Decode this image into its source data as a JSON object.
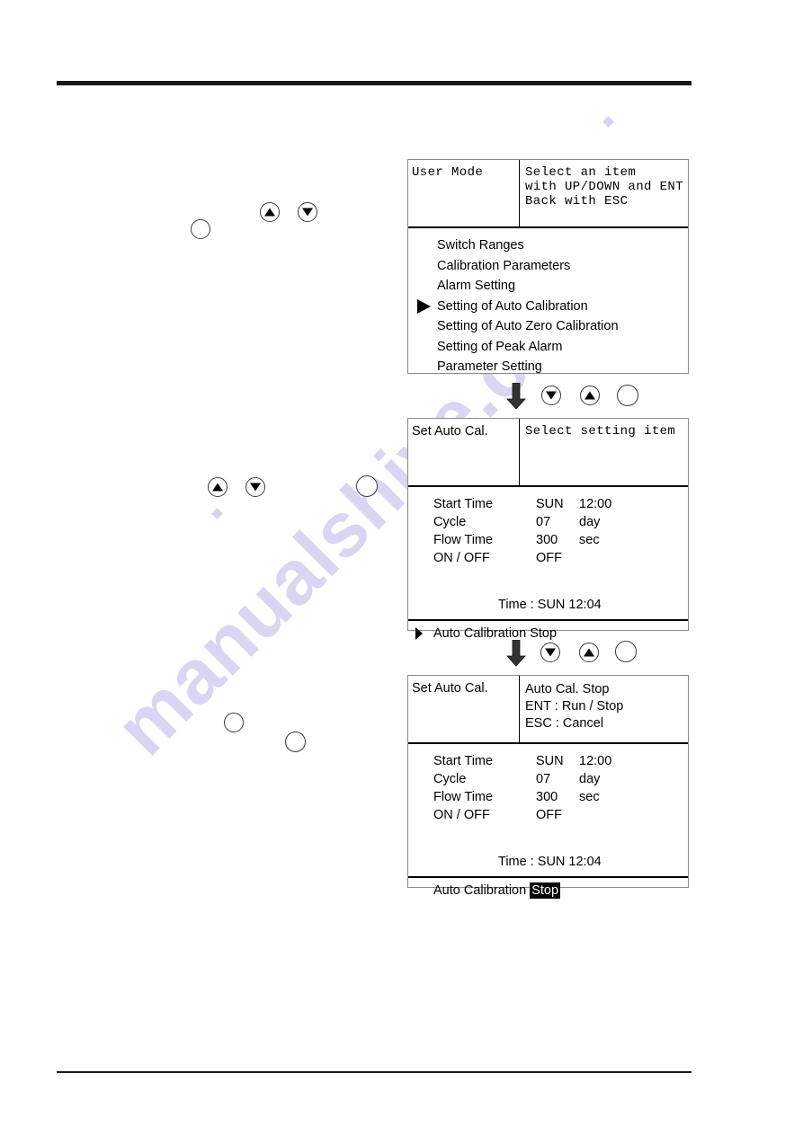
{
  "document": {
    "type": "instrument-manual-page",
    "rules": {
      "top": "horizontal-rule",
      "bottom": "horizontal-rule"
    },
    "watermark": "manualshive.com"
  },
  "panels": [
    {
      "id": "user-mode",
      "title": "User Mode",
      "guidance": [
        "Select an item",
        "with UP/DOWN and ENT",
        "Back with ESC"
      ],
      "menu": [
        {
          "label": "Switch Ranges",
          "selected": false
        },
        {
          "label": "Calibration Parameters",
          "selected": false
        },
        {
          "label": "Alarm Setting",
          "selected": false
        },
        {
          "label": "Setting of Auto Calibration",
          "selected": true
        },
        {
          "label": "Setting of Auto Zero Calibration",
          "selected": false
        },
        {
          "label": "Setting of Peak Alarm",
          "selected": false
        },
        {
          "label": "Parameter Setting",
          "selected": false
        }
      ]
    },
    {
      "id": "set-auto-cal-select",
      "title": "Set Auto Cal.",
      "guidance": [
        "Select setting item"
      ],
      "settings": [
        {
          "label": "Start  Time",
          "value": "SUN",
          "unit": "12:00"
        },
        {
          "label": "Cycle",
          "value": "07",
          "unit": "day"
        },
        {
          "label": "Flow Time",
          "value": "300",
          "unit": "sec"
        },
        {
          "label": "ON / OFF",
          "value": "OFF",
          "unit": ""
        }
      ],
      "clock": "Time : SUN  12:04",
      "footer": {
        "text": "Auto Calibration Stop",
        "cursor": true,
        "highlight": ""
      }
    },
    {
      "id": "set-auto-cal-confirm",
      "title": "Set Auto Cal.",
      "guidance": [
        "Auto Cal. Stop",
        "ENT : Run / Stop",
        "ESC : Cancel"
      ],
      "settings": [
        {
          "label": "Start  Time",
          "value": "SUN",
          "unit": "12:00"
        },
        {
          "label": "Cycle",
          "value": "07",
          "unit": "day"
        },
        {
          "label": "Flow Time",
          "value": "300",
          "unit": "sec"
        },
        {
          "label": "ON / OFF",
          "value": "OFF",
          "unit": ""
        }
      ],
      "clock": "Time : SUN  12:04",
      "footer": {
        "text": "Auto Calibration ",
        "cursor": false,
        "highlight": "Stop"
      }
    }
  ],
  "keys": {
    "enter_key": "enter-key",
    "up_key": "up-key",
    "down_key": "down-key",
    "flow_arrow": "down-arrow"
  }
}
